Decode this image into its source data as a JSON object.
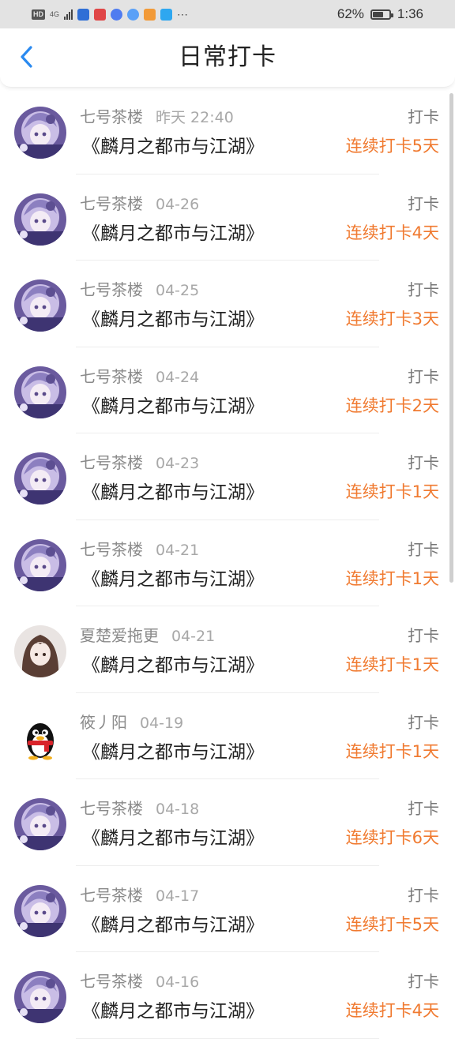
{
  "status_bar": {
    "battery": "62%",
    "time": "1:36",
    "network": "4G",
    "hd": "HD",
    "app_icon_colors": [
      "#2f6fd6",
      "#e04646",
      "#4f7cf0",
      "#5aa0f7",
      "#f29a38",
      "#2ea7f0"
    ]
  },
  "header": {
    "back_icon": "chevron-left-icon",
    "title": "日常打卡",
    "accent": "#2a8af0"
  },
  "colors": {
    "streak": "#f07a30"
  },
  "list": {
    "items": [
      {
        "user": "七号茶楼",
        "date": "昨天 22:40",
        "tag": "打卡",
        "book": "《麟月之都市与江湖》",
        "streak": "连续打卡5天",
        "avatar": "anime-girl-avatar"
      },
      {
        "user": "七号茶楼",
        "date": "04-26",
        "tag": "打卡",
        "book": "《麟月之都市与江湖》",
        "streak": "连续打卡4天",
        "avatar": "anime-girl-avatar"
      },
      {
        "user": "七号茶楼",
        "date": "04-25",
        "tag": "打卡",
        "book": "《麟月之都市与江湖》",
        "streak": "连续打卡3天",
        "avatar": "anime-girl-avatar"
      },
      {
        "user": "七号茶楼",
        "date": "04-24",
        "tag": "打卡",
        "book": "《麟月之都市与江湖》",
        "streak": "连续打卡2天",
        "avatar": "anime-girl-avatar"
      },
      {
        "user": "七号茶楼",
        "date": "04-23",
        "tag": "打卡",
        "book": "《麟月之都市与江湖》",
        "streak": "连续打卡1天",
        "avatar": "anime-girl-avatar"
      },
      {
        "user": "七号茶楼",
        "date": "04-21",
        "tag": "打卡",
        "book": "《麟月之都市与江湖》",
        "streak": "连续打卡1天",
        "avatar": "anime-girl-avatar"
      },
      {
        "user": "夏楚爱拖更",
        "date": "04-21",
        "tag": "打卡",
        "book": "《麟月之都市与江湖》",
        "streak": "连续打卡1天",
        "avatar": "brown-hair-girl-avatar"
      },
      {
        "user": "筱丿阳",
        "date": "04-19",
        "tag": "打卡",
        "book": "《麟月之都市与江湖》",
        "streak": "连续打卡1天",
        "avatar": "qq-penguin-avatar"
      },
      {
        "user": "七号茶楼",
        "date": "04-18",
        "tag": "打卡",
        "book": "《麟月之都市与江湖》",
        "streak": "连续打卡6天",
        "avatar": "anime-girl-avatar"
      },
      {
        "user": "七号茶楼",
        "date": "04-17",
        "tag": "打卡",
        "book": "《麟月之都市与江湖》",
        "streak": "连续打卡5天",
        "avatar": "anime-girl-avatar"
      },
      {
        "user": "七号茶楼",
        "date": "04-16",
        "tag": "打卡",
        "book": "《麟月之都市与江湖》",
        "streak": "连续打卡4天",
        "avatar": "anime-girl-avatar"
      }
    ]
  }
}
